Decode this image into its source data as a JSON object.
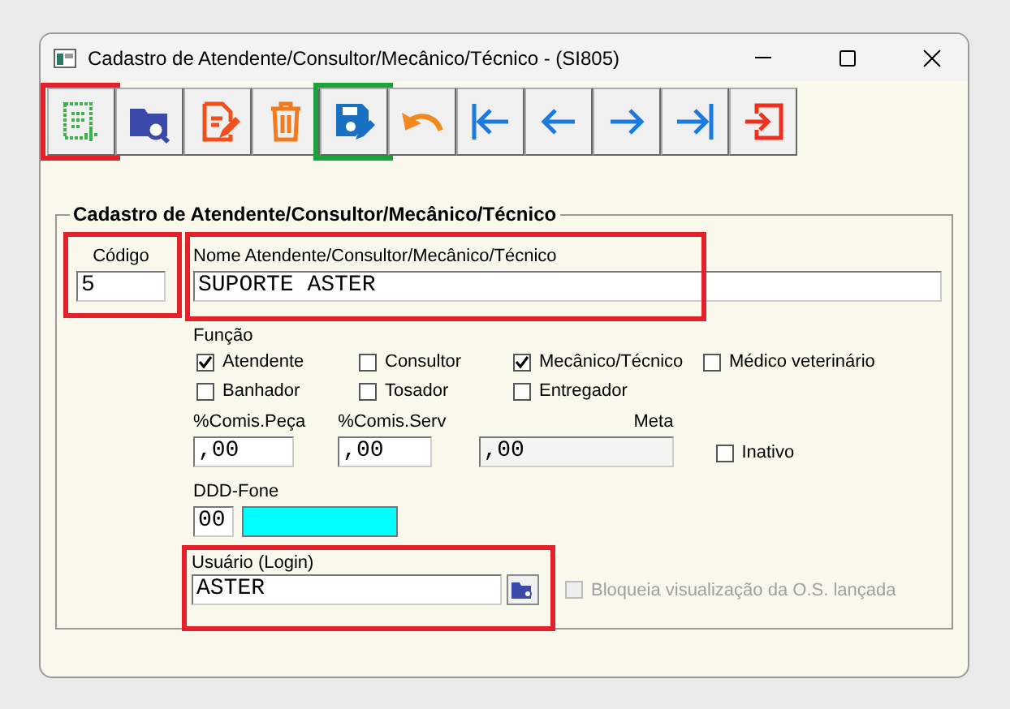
{
  "window": {
    "title": "Cadastro de Atendente/Consultor/Mecânico/Técnico - (SI805)"
  },
  "toolbar": [
    {
      "kind": "new",
      "color": "#e5202b"
    },
    {
      "kind": "search"
    },
    {
      "kind": "edit"
    },
    {
      "kind": "delete"
    },
    {
      "kind": "save",
      "color": "#1aa33a"
    },
    {
      "kind": "undo"
    },
    {
      "kind": "first"
    },
    {
      "kind": "prev"
    },
    {
      "kind": "next"
    },
    {
      "kind": "last"
    },
    {
      "kind": "exit"
    }
  ],
  "form": {
    "legend": "Cadastro de Atendente/Consultor/Mecânico/Técnico",
    "codigo": {
      "label": "Código",
      "value": "5",
      "framed": true
    },
    "nome": {
      "label": "Nome Atendente/Consultor/Mecânico/Técnico",
      "value": "SUPORTE ASTER",
      "framed": true
    },
    "funcao": {
      "label": "Função",
      "options": [
        {
          "label": "Atendente",
          "checked": true
        },
        {
          "label": "Consultor",
          "checked": false
        },
        {
          "label": "Mecânico/Técnico",
          "checked": true
        },
        {
          "label": "Médico veterinário",
          "checked": false
        },
        {
          "label": "Banhador",
          "checked": false
        },
        {
          "label": "Tosador",
          "checked": false
        },
        {
          "label": "Entregador",
          "checked": false
        }
      ]
    },
    "comissao": [
      {
        "label": "%Comis.Peça",
        "value": ",00",
        "disabled": false
      },
      {
        "label": "%Comis.Serv",
        "value": ",00",
        "disabled": false
      },
      {
        "label": "Meta",
        "value": ",00",
        "disabled": true
      }
    ],
    "inativo": {
      "label": "Inativo",
      "checked": false
    },
    "ddd_fone": {
      "label": "DDD-Fone",
      "ddd": "00",
      "fone_focused": true
    },
    "usuario": {
      "label": "Usuário (Login)",
      "value": "ASTER",
      "framed": true
    },
    "bloqueia": {
      "label": "Bloqueia visualização da O.S. lançada",
      "checked": false,
      "disabled": true
    }
  }
}
